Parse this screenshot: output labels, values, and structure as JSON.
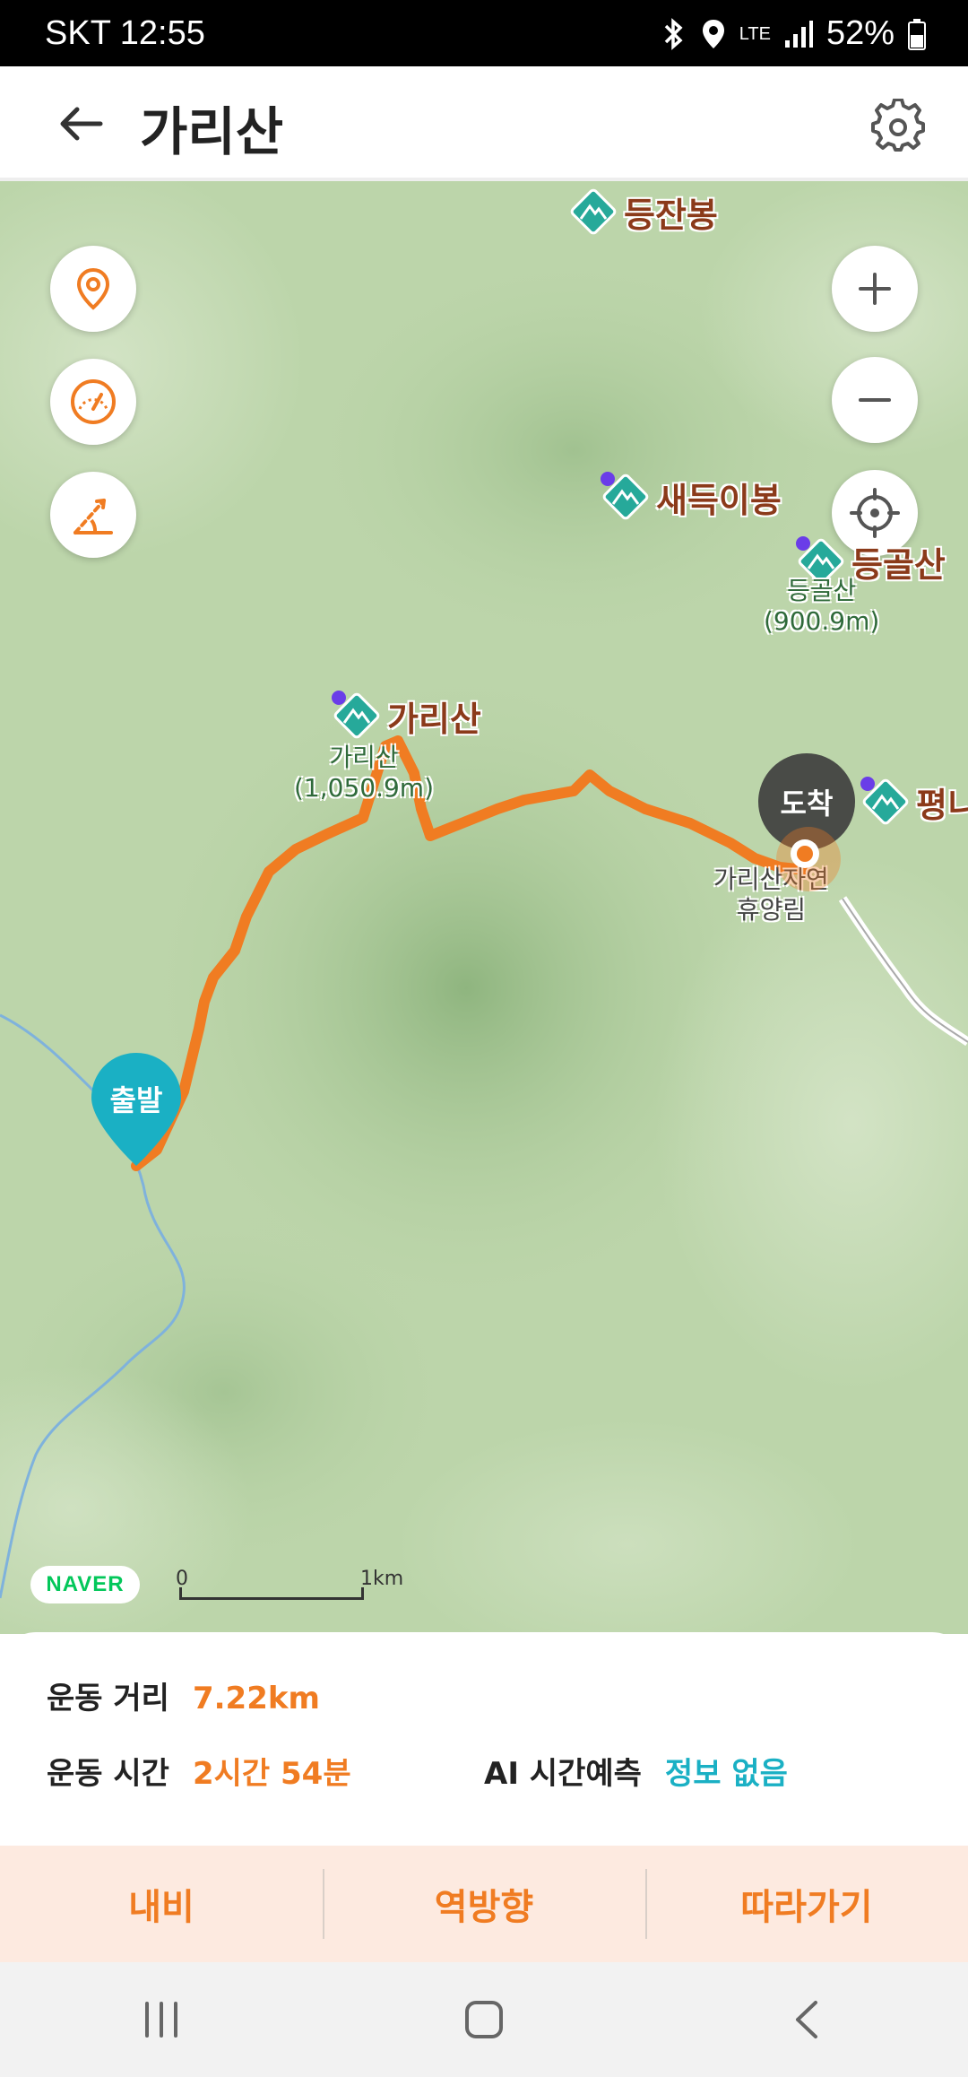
{
  "status": {
    "carrier": "SKT",
    "time": "12:55",
    "network": "LTE",
    "battery": "52%"
  },
  "header": {
    "title": "가리산",
    "back_icon": "arrow-left-icon",
    "settings_icon": "gear-icon"
  },
  "map": {
    "peaks": [
      {
        "name": "등잔봉"
      },
      {
        "name": "새득이봉"
      },
      {
        "name": "등골산",
        "sub_name": "등골산",
        "sub_height": "(900.9m)"
      },
      {
        "name": "가리산",
        "sub_name": "가리산",
        "sub_height": "(1,050.9m)"
      },
      {
        "name": "평니"
      }
    ],
    "poi": {
      "line1": "가리산자연",
      "line2": "휴양림"
    },
    "start_label": "출발",
    "end_label": "도착",
    "brand": "NAVER",
    "scale_start": "0",
    "scale_end": "1km",
    "colors": {
      "route": "#f07c22",
      "peak": "#26a99a",
      "start": "#1ab0c4"
    }
  },
  "info": {
    "distance_label": "운동 거리",
    "distance_value": "7.22km",
    "time_label": "운동 시간",
    "time_value": "2시간 54분",
    "ai_label": "AI 시간예측",
    "ai_value": "정보 없음"
  },
  "actions": {
    "navi": "내비",
    "reverse": "역방향",
    "follow": "따라가기"
  }
}
